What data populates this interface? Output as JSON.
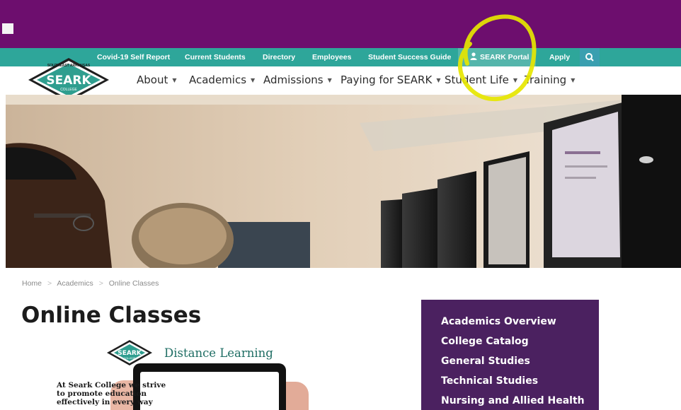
{
  "utility_nav": {
    "links": [
      "Covid-19 Self Report",
      "Current Students",
      "Directory",
      "Employees",
      "Student Success Guide"
    ],
    "portal_label": "SEARK Portal",
    "portal_icon": "user-icon",
    "apply_label": "Apply",
    "search_icon": "search-icon"
  },
  "logo": {
    "top_text": "SOUTHEAST ARKANSAS",
    "name": "SEARK",
    "sub": "COLLEGE"
  },
  "main_nav": {
    "items": [
      "About",
      "Academics",
      "Admissions",
      "Paying for SEARK",
      "Student Life",
      "Training"
    ]
  },
  "breadcrumb": {
    "items": [
      "Home",
      "Academics",
      "Online Classes"
    ],
    "separator": ">"
  },
  "page": {
    "title": "Online Classes"
  },
  "promo": {
    "logo_name": "SEARK",
    "logo_sub": "COLLEGE",
    "title": "Distance Learning",
    "tablet_text": "At Seark College we strive to promote education effectively in every way"
  },
  "sidebar": {
    "links": [
      "Academics Overview",
      "College Catalog",
      "General Studies",
      "Technical Studies",
      "Nursing and Allied Health"
    ]
  },
  "colors": {
    "purple_band": "#6d0e6e",
    "teal_bar": "#2ea69a",
    "sidebar_bg": "#4b2160",
    "annotation": "#e6e600"
  }
}
